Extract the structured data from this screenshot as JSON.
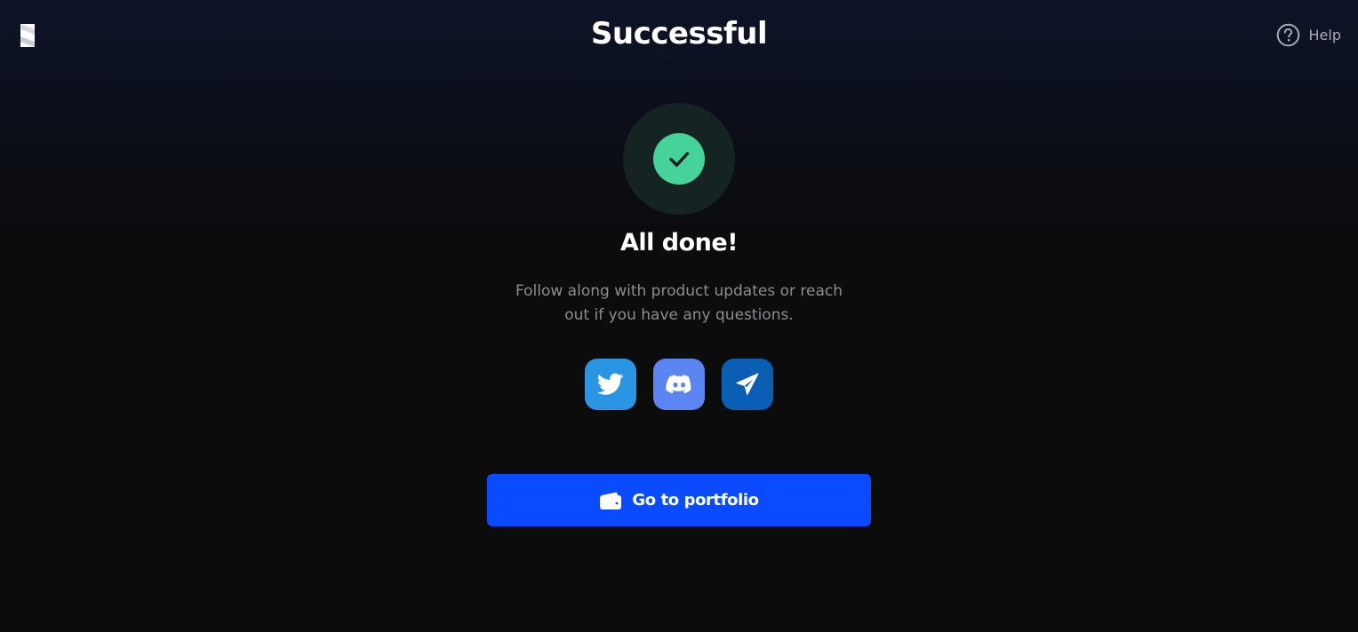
{
  "header": {
    "title": "Successful",
    "help_label": "Help"
  },
  "status": {
    "headline": "All done!",
    "message": "Follow along with product updates or reach out if you have any questions."
  },
  "socials": [
    {
      "name": "twitter",
      "icon": "twitter-bird-icon",
      "color": "#2a95e3"
    },
    {
      "name": "discord",
      "icon": "discord-icon",
      "color": "#5b86f2"
    },
    {
      "name": "telegram",
      "icon": "paper-plane-icon",
      "color": "#0a5fb4"
    }
  ],
  "cta": {
    "label": "Go to portfolio",
    "icon": "wallet-icon",
    "color": "#0a4bff"
  },
  "colors": {
    "success": "#45d39a",
    "success_ring": "#152423",
    "background": "#0c0c0d"
  }
}
